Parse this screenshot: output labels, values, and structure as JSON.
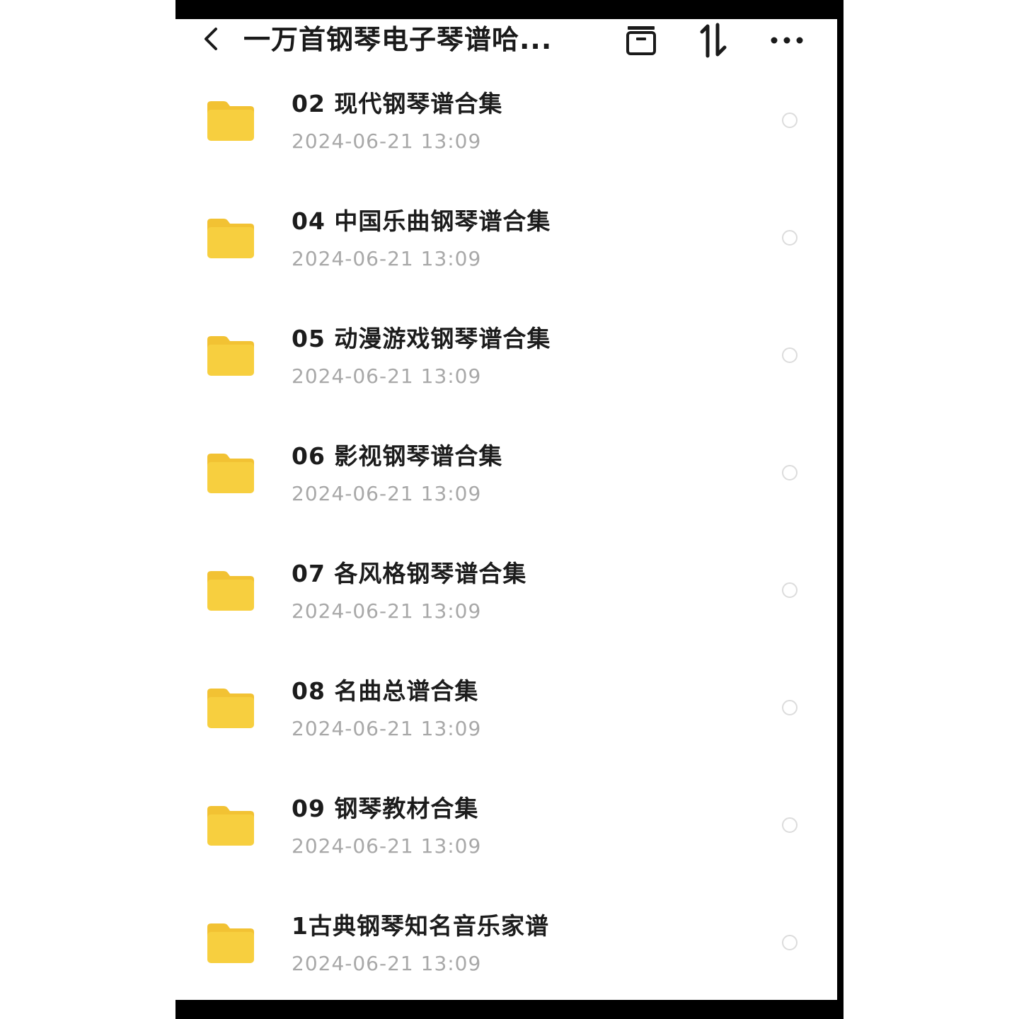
{
  "header": {
    "title": "一万首钢琴电子琴谱哈...",
    "back_icon": "chevron-left-icon",
    "archive_icon": "archive-icon",
    "sort_icon": "sort-icon",
    "more_icon": "more-icon"
  },
  "colors": {
    "folder": "#f7cf3f",
    "folder_tab": "#f2c233",
    "title_text": "#1a1a1a",
    "date_text": "#a8a8a8",
    "radio_border": "#dcdcdc"
  },
  "folders": [
    {
      "name": "02 现代钢琴谱合集",
      "date": "2024-06-21  13:09"
    },
    {
      "name": "04 中国乐曲钢琴谱合集",
      "date": "2024-06-21  13:09"
    },
    {
      "name": "05 动漫游戏钢琴谱合集",
      "date": "2024-06-21  13:09"
    },
    {
      "name": "06 影视钢琴谱合集",
      "date": "2024-06-21  13:09"
    },
    {
      "name": "07 各风格钢琴谱合集",
      "date": "2024-06-21  13:09"
    },
    {
      "name": "08 名曲总谱合集",
      "date": "2024-06-21  13:09"
    },
    {
      "name": "09 钢琴教材合集",
      "date": "2024-06-21  13:09"
    },
    {
      "name": "1古典钢琴知名音乐家谱",
      "date": "2024-06-21  13:09"
    }
  ]
}
